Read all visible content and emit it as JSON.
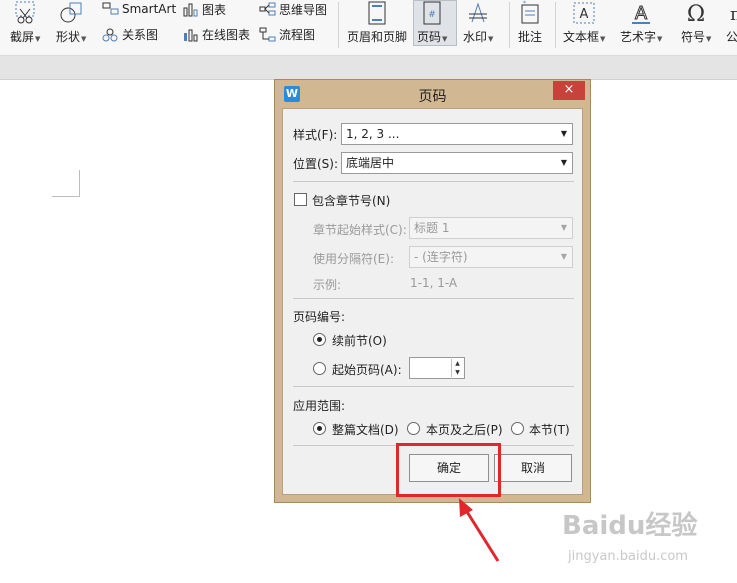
{
  "ribbon": {
    "screenshot_label": "截屏",
    "shape_label": "形状",
    "smartart_label": "SmartArt",
    "relation_label": "关系图",
    "chart_label": "图表",
    "online_chart_label": "在线图表",
    "mindmap_label": "思维导图",
    "flowchart_label": "流程图",
    "header_footer_label": "页眉和页脚",
    "page_number_label": "页码",
    "watermark_label": "水印",
    "comment_label": "批注",
    "textbox_label": "文本框",
    "wordart_label": "艺术字",
    "symbol_label": "符号",
    "formula_label": "公"
  },
  "dialog": {
    "title": "页码",
    "logo": "W",
    "close": "×",
    "style_label": "样式(F):",
    "style_value": "1, 2, 3 ...",
    "position_label": "位置(S):",
    "position_value": "底端居中",
    "include_chapter_label": "包含章节号(N)",
    "chapter_style_label": "章节起始样式(C):",
    "chapter_style_value": "标题 1",
    "separator_label": "使用分隔符(E):",
    "separator_value": "-    (连字符)",
    "example_label": "示例:",
    "example_value": "1-1, 1-A",
    "numbering_label": "页码编号:",
    "continue_label": "续前节(O)",
    "start_label": "起始页码(A):",
    "start_value": "",
    "scope_label": "应用范围:",
    "scope_whole": "整篇文档(D)",
    "scope_after": "本页及之后(P)",
    "scope_section": "本节(T)",
    "ok_label": "确定",
    "cancel_label": "取消"
  },
  "watermark": {
    "brand": "Baidu经验",
    "url": "jingyan.baidu.com"
  },
  "colors": {
    "dialog_frame": "#d2b892",
    "close_button": "#c7423a",
    "highlight": "#e0282c"
  }
}
